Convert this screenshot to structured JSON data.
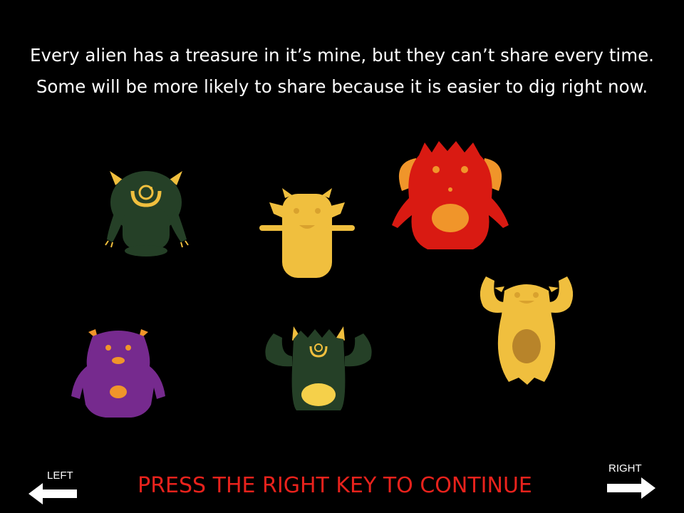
{
  "instructions": {
    "line1": "Every alien has a treasure in it’s mine, but they can’t share every time.",
    "line2": "Some will be more likely to share because it is easier to dig right now."
  },
  "prompt": {
    "continue_text": "PRESS THE RIGHT KEY TO CONTINUE"
  },
  "keys": {
    "left_label": "LEFT",
    "right_label": "RIGHT"
  },
  "colors": {
    "background": "#000000",
    "text": "#ffffff",
    "prompt": "#e8221c",
    "alien_dark_green": "#254027",
    "alien_yellow": "#f0bf3e",
    "alien_red": "#d91a12",
    "alien_purple": "#762a8e",
    "accent_orange": "#f0952a"
  },
  "aliens": [
    {
      "name": "green-cyclops-alien"
    },
    {
      "name": "yellow-horned-alien"
    },
    {
      "name": "red-furry-alien"
    },
    {
      "name": "yellow-arms-up-alien"
    },
    {
      "name": "purple-alien"
    },
    {
      "name": "green-arms-up-alien"
    }
  ]
}
